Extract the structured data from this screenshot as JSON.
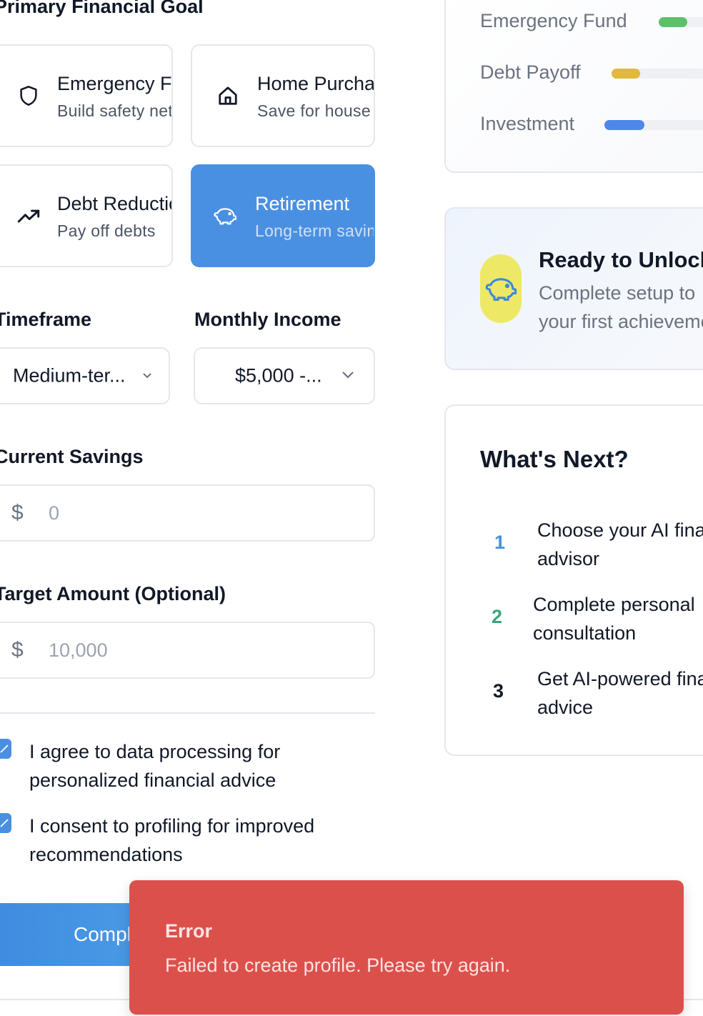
{
  "form": {
    "goal_section_label": "Primary Financial Goal",
    "goals": [
      {
        "title": "Emergency Fund",
        "subtitle": "Build safety net",
        "icon": "shield-icon",
        "selected": false
      },
      {
        "title": "Home Purchase",
        "subtitle": "Save for house",
        "icon": "home-icon",
        "selected": false
      },
      {
        "title": "Debt Reduction",
        "subtitle": "Pay off debts",
        "icon": "trending-up-icon",
        "selected": false
      },
      {
        "title": "Retirement",
        "subtitle": "Long-term savings",
        "icon": "piggy-bank-icon",
        "selected": true
      }
    ],
    "timeframe_label": "Timeframe",
    "timeframe_value": "Medium-ter...",
    "income_label": "Monthly Income",
    "income_value": "$5,000 -...",
    "savings_label": "Current Savings",
    "savings_currency": "$",
    "savings_placeholder": "0",
    "target_label": "Target Amount (Optional)",
    "target_currency": "$",
    "target_placeholder": "10,000",
    "consent_data": "I agree to data processing for personalized financial advice",
    "consent_profiling": "I consent to profiling for improved recommendations",
    "consent_data_checked": true,
    "consent_profiling_checked": true,
    "submit_label": "Complete Setup"
  },
  "progress": {
    "items": [
      {
        "label": "Emergency Fund",
        "color": "#5cc26a",
        "fraction": 0.2
      },
      {
        "label": "Debt Payoff",
        "color": "#e2b83e",
        "fraction": 0.2
      },
      {
        "label": "Investment",
        "color": "#4f86ea",
        "fraction": 0.28
      }
    ]
  },
  "unlock": {
    "title": "Ready to Unlock",
    "text_line1": "Complete setup to",
    "text_line2": "your first achievement",
    "icon": "piggy-bank-icon",
    "badge_color": "#ede966"
  },
  "next": {
    "title": "What's Next?",
    "steps": [
      {
        "num": "1",
        "line1": "Choose your AI financial",
        "line2": "advisor",
        "color": "#4a90e2"
      },
      {
        "num": "2",
        "line1": "Complete personal",
        "line2": "consultation",
        "color": "#3aa57a"
      },
      {
        "num": "3",
        "line1": "Get AI-powered financial",
        "line2": "advice",
        "color": "#111827"
      }
    ]
  },
  "toast": {
    "title": "Error",
    "message": "Failed to create profile. Please try again.",
    "color": "#dc504c"
  }
}
